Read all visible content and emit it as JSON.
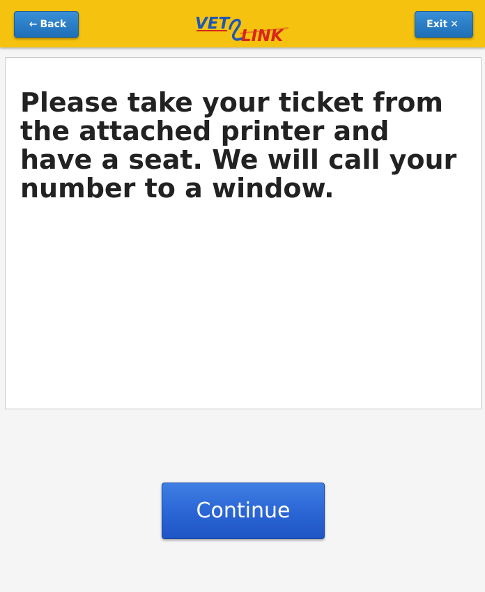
{
  "header": {
    "back_label": "Back",
    "exit_label": "Exit",
    "logo": {
      "text_left": "VET",
      "text_right": "LINK",
      "colors": {
        "vet": "#1f57b4",
        "link": "#d8251d",
        "swoosh": "#1f57b4"
      }
    },
    "icons": {
      "back": "arrow-left-icon",
      "exit": "close-icon"
    },
    "background": "#f4c20f",
    "button_color": "#2a7fc8"
  },
  "main": {
    "message": "Please take your ticket from the attached printer and have a seat. We will call your number to a window."
  },
  "footer": {
    "continue_label": "Continue",
    "button_color": "#2c67d6"
  }
}
